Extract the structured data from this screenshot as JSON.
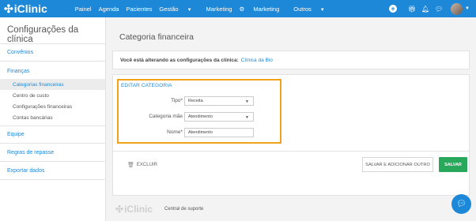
{
  "topbar": {
    "logo_text": "iClinic",
    "nav": {
      "painel": "Painel",
      "agenda": "Agenda",
      "pacientes": "Pacientes",
      "gestao": "Gestão",
      "marketing": "Marketing",
      "marketing2": "Marketing",
      "outros": "Outros"
    },
    "icons": [
      "plus-icon",
      "gift-icon",
      "bell-icon",
      "chat-icon",
      "avatar"
    ]
  },
  "sidebar": {
    "title": "Configurações da clínica",
    "items": {
      "convenios": "Convênios",
      "financas": "Finanças",
      "sub": [
        "Categorias financeiras",
        "Centro de custo",
        "Configurações financeiras",
        "Contas bancárias"
      ],
      "equipe": "Equipe",
      "regras": "Regras de repasse",
      "exportar": "Exportar dados"
    }
  },
  "main": {
    "page_title": "Categoria financeira",
    "info_prefix": "Você está alterando as configurações da clínica:",
    "clinic_name": "Clínica da Bio",
    "form": {
      "section_title": "EDITAR CATEGORIA",
      "tipo_label": "Tipo*",
      "tipo_value": "Receita",
      "categoria_label": "Categoria mãe",
      "categoria_value": "Atendimento",
      "nome_label": "Nome*",
      "nome_value": "Atendimento"
    },
    "actions": {
      "excluir": "EXCLUIR",
      "salvar_outro": "SALVAR E ADICIONAR OUTRO",
      "salvar": "SALVAR"
    }
  },
  "footer": {
    "logo_text": "iClinic",
    "support": "Central de suporte"
  },
  "colors": {
    "brand": "#1e88d8",
    "highlight": "#f0a21b",
    "save": "#28a85a"
  }
}
